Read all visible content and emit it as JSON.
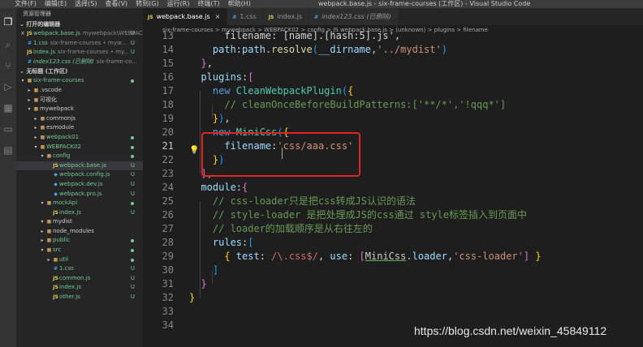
{
  "menu": {
    "items": [
      "文件(F)",
      "编辑(E)",
      "选择(S)",
      "查看(V)",
      "转到(G)",
      "运行(R)",
      "终端(T)",
      "帮助(H)"
    ],
    "window_title": "webpack.base.js - six-frame-courses (工作区) - Visual Studio Code"
  },
  "sidebar": {
    "title": "资源管理器",
    "open_editors_header": "打开的编辑器",
    "open_editors": [
      {
        "icon": "JS",
        "name": "webpack.base.js",
        "desc": "mywebpack\\WEBPAC...",
        "badge": "U",
        "close": "×"
      },
      {
        "icon": "#",
        "name": "1.css",
        "desc": "six-frame-courses • myw...",
        "badge": "U"
      },
      {
        "icon": "JS",
        "name": "index.js",
        "desc": "six-frame-courses • my...",
        "badge": "U"
      },
      {
        "icon": "#",
        "name": "index123.css (已删除)",
        "desc": "six-frame-co...",
        "badge": ""
      }
    ],
    "workspace_header": "无标题 (工作区)",
    "tree": [
      {
        "kind": "folder",
        "name": "six-frame-courses",
        "open": true,
        "status": "dot"
      },
      {
        "kind": "folder",
        "name": ".vscode",
        "open": false,
        "status": ""
      },
      {
        "kind": "folder",
        "name": "可视化",
        "open": false,
        "status": ""
      },
      {
        "kind": "folder",
        "name": "mywebpack",
        "open": true,
        "status": ""
      },
      {
        "kind": "folder",
        "name": "commonjs",
        "open": false,
        "status": ""
      },
      {
        "kind": "folder",
        "name": "esmodule",
        "open": false,
        "status": ""
      },
      {
        "kind": "folder",
        "name": "webpack01",
        "open": false,
        "status": "dot"
      },
      {
        "kind": "folder",
        "name": "WEBPACK02",
        "open": true,
        "status": "dot"
      },
      {
        "kind": "folder",
        "name": "config",
        "open": true,
        "status": "dot"
      },
      {
        "kind": "js",
        "name": "webpack.base.js",
        "status": "U",
        "active": true
      },
      {
        "kind": "cfg",
        "name": "webpack.config.js",
        "status": "U"
      },
      {
        "kind": "cfg",
        "name": "webpack.dev.js",
        "status": "U"
      },
      {
        "kind": "cfg",
        "name": "webpack.pro.js",
        "status": "U"
      },
      {
        "kind": "folder",
        "name": "mockApi",
        "open": true,
        "status": "dot"
      },
      {
        "kind": "js",
        "name": "index.js",
        "status": "U"
      },
      {
        "kind": "folder",
        "name": "mydist",
        "open": true,
        "status": ""
      },
      {
        "kind": "folder",
        "name": "node_modules",
        "open": false,
        "status": ""
      },
      {
        "kind": "folder",
        "name": "public",
        "open": false,
        "status": "dot"
      },
      {
        "kind": "folder",
        "name": "src",
        "open": true,
        "status": "dot"
      },
      {
        "kind": "folder",
        "name": "util",
        "open": false,
        "status": "dot"
      },
      {
        "kind": "css",
        "name": "1.css",
        "status": "U"
      },
      {
        "kind": "js",
        "name": "common.js",
        "status": "U"
      },
      {
        "kind": "js",
        "name": "index.js",
        "status": "U"
      },
      {
        "kind": "js",
        "name": "other.js",
        "status": "U"
      }
    ]
  },
  "tabs": [
    {
      "icon": "JS",
      "label": "webpack.base.js",
      "active": true,
      "close": "×"
    },
    {
      "icon": "#",
      "label": "1.css",
      "active": false
    },
    {
      "icon": "JS",
      "label": "index.js",
      "active": false
    },
    {
      "icon": "#",
      "label": "index123.css (已删除)",
      "active": false
    }
  ],
  "breadcrumb": "six-frame-courses > mywebpack > WEBPACK02 > config > JS webpack.base.js > ⟨unknown⟩ > plugins > filename",
  "editor": {
    "lines": [
      {
        "n": "13",
        "tokens": [
          [
            "pl",
            "      filename: [name].[hash:5].js',"
          ]
        ]
      },
      {
        "n": "14",
        "tokens": [
          [
            "prop",
            "    path"
          ],
          [
            "pl",
            ":"
          ],
          [
            "prop",
            "path"
          ],
          [
            "pl",
            "."
          ],
          [
            "fn",
            "resolve"
          ],
          [
            "p3",
            "("
          ],
          [
            "prop",
            "__dirname"
          ],
          [
            "pl",
            ","
          ],
          [
            "str",
            "'../mydist'"
          ],
          [
            "p3",
            ")"
          ]
        ]
      },
      {
        "n": "15",
        "tokens": [
          [
            "p2",
            "  }"
          ],
          [
            "pl",
            ","
          ]
        ]
      },
      {
        "n": "16",
        "tokens": [
          [
            "prop",
            "  plugins"
          ],
          [
            "pl",
            ":"
          ],
          [
            "p2",
            "["
          ]
        ]
      },
      {
        "n": "17",
        "tokens": [
          [
            "kw",
            "    new "
          ],
          [
            "cls",
            "CleanWebpackPlugin"
          ],
          [
            "p3",
            "("
          ],
          [
            "p1",
            "{"
          ]
        ]
      },
      {
        "n": "18",
        "tokens": [
          [
            "cmt",
            "      // cleanOnceBeforeBuildPatterns:['**/*','!qqq*']"
          ]
        ]
      },
      {
        "n": "19",
        "tokens": [
          [
            "p1",
            "    }"
          ],
          [
            "p3",
            ")"
          ],
          [
            "pl",
            ","
          ]
        ]
      },
      {
        "n": "20",
        "tokens": [
          [
            "kw",
            "    new "
          ],
          [
            "cls",
            "MiniCss"
          ],
          [
            "p3",
            "("
          ],
          [
            "p1",
            "{"
          ]
        ]
      },
      {
        "n": "21",
        "tokens": [
          [
            "prop",
            "      filename"
          ],
          [
            "pl",
            ":"
          ],
          [
            "str",
            "'css/aaa.css'"
          ]
        ]
      },
      {
        "n": "22",
        "tokens": [
          [
            "p1",
            "    }"
          ],
          [
            "p3",
            ")"
          ]
        ]
      },
      {
        "n": "23",
        "tokens": [
          [
            "p2",
            "  ]"
          ],
          [
            "pl",
            ","
          ]
        ]
      },
      {
        "n": "24",
        "tokens": [
          [
            "prop",
            "  module"
          ],
          [
            "pl",
            ":"
          ],
          [
            "p2",
            "{"
          ]
        ]
      },
      {
        "n": "25",
        "tokens": [
          [
            "cmt",
            "    // css-loader只是把css转成JS认识的语法"
          ]
        ]
      },
      {
        "n": "26",
        "tokens": [
          [
            "cmt",
            "    // style-loader 是把处理成JS的css通过 style标签插入到页面中"
          ]
        ]
      },
      {
        "n": "27",
        "tokens": [
          [
            "cmt",
            "    // loader的加载顺序是从右往左的"
          ]
        ]
      },
      {
        "n": "28",
        "tokens": [
          [
            "prop",
            "    rules"
          ],
          [
            "pl",
            ":"
          ],
          [
            "p3",
            "["
          ]
        ]
      },
      {
        "n": "29",
        "tokens": [
          [
            "p1",
            "      { "
          ],
          [
            "prop",
            "test"
          ],
          [
            "pl",
            ": "
          ],
          [
            "rgx",
            "/\\.css$/"
          ],
          [
            "pl",
            ", "
          ],
          [
            "prop",
            "use"
          ],
          [
            "pl",
            ": "
          ],
          [
            "p2",
            "["
          ],
          [
            "squig",
            "MiniCss"
          ],
          [
            "pl",
            "."
          ],
          [
            "prop",
            "loader"
          ],
          [
            "pl",
            ","
          ],
          [
            "str",
            "'css-loader'"
          ],
          [
            "p2",
            "]"
          ],
          [
            "p1",
            " }"
          ]
        ]
      },
      {
        "n": "30",
        "tokens": [
          [
            "p3",
            "    ]"
          ]
        ]
      },
      {
        "n": "31",
        "tokens": [
          [
            "p2",
            "  }"
          ]
        ]
      },
      {
        "n": "32",
        "tokens": [
          [
            "p1",
            "}"
          ]
        ]
      },
      {
        "n": "33",
        "tokens": []
      },
      {
        "n": "34",
        "tokens": []
      }
    ],
    "current_line": "21",
    "lightbulb": "💡"
  },
  "watermark": "https://blog.csdn.net/weixin_45849112",
  "colors": {
    "highlight_box": "#e02424",
    "untracked": "#73c991"
  }
}
